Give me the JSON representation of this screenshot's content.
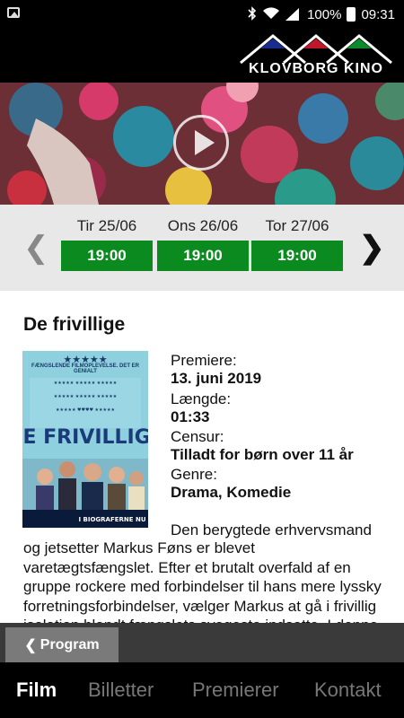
{
  "status_bar": {
    "battery": "100%",
    "time": "09:31"
  },
  "brand": {
    "logo_text": "KLOVBORG KINO",
    "triangle_colors": [
      "#1a2b8f",
      "#c0182a",
      "#0a8a2a"
    ]
  },
  "showtimes": {
    "days": [
      {
        "label": "Tir 25/06",
        "time": "19:00"
      },
      {
        "label": "Ons 26/06",
        "time": "19:00"
      },
      {
        "label": "Tor 27/06",
        "time": "19:00"
      }
    ]
  },
  "movie": {
    "title": "De frivillige",
    "poster": {
      "tagline": "FÆNGSLENDE FILMOPLEVELSE. DET ER GENIALT",
      "title": "DE FRIVILLIGE",
      "bottom": "I BIOGRAFERNE NU"
    },
    "premiere_label": "Premiere:",
    "premiere_value": "13. juni 2019",
    "length_label": "Længde:",
    "length_value": "01:33",
    "censor_label": "Censur:",
    "censor_value": "Tilladt for børn over 11 år",
    "genre_label": "Genre:",
    "genre_value": "Drama, Komedie",
    "description_first": "Den berygtede erhvervsmand",
    "description_rest": "og jetsetter Markus Føns er blevet varetægtsfængslet. Efter et brutalt overfald af en gruppe rockere med forbindelser til hans mere lyssky forretningsforbindelser, vælger Markus at gå i frivillig isolation blandt fængslets svageste indsatte. I denne"
  },
  "nav": {
    "back_label": "Program",
    "tabs": [
      "Film",
      "Billetter",
      "Premierer",
      "Kontakt"
    ]
  }
}
